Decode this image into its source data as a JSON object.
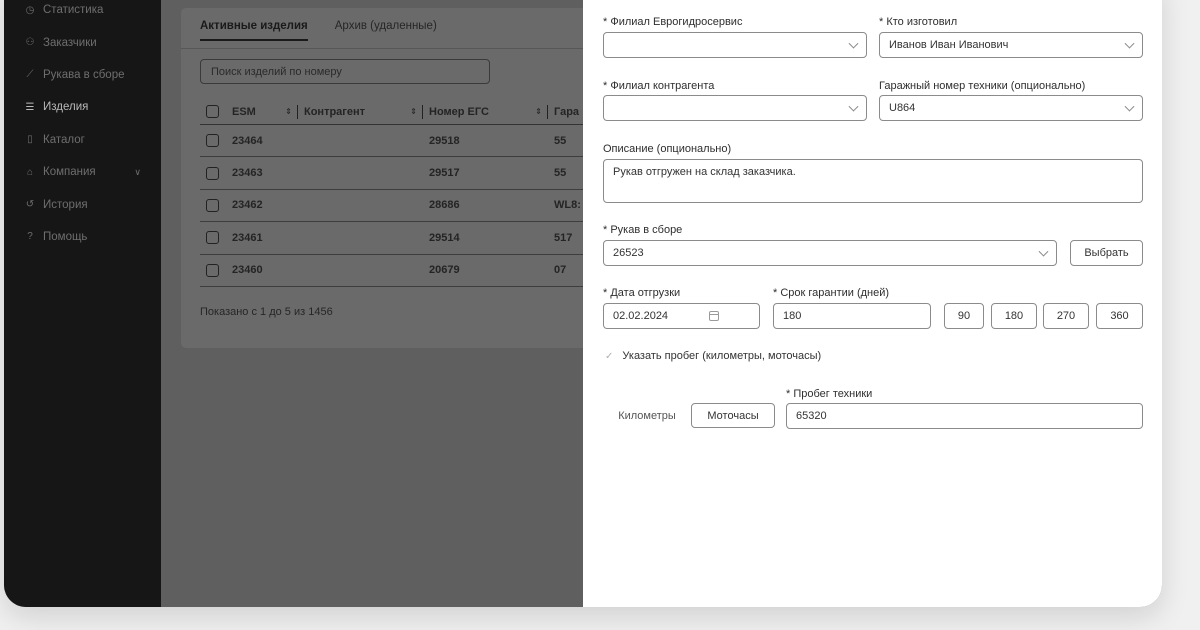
{
  "sidebar": {
    "items": [
      {
        "label": "Статистика",
        "icon": "clock-icon"
      },
      {
        "label": "Заказчики",
        "icon": "users-icon"
      },
      {
        "label": "Рукава в сборе",
        "icon": "hose-icon"
      },
      {
        "label": "Изделия",
        "icon": "list-icon",
        "active": true
      },
      {
        "label": "Каталог",
        "icon": "book-icon"
      },
      {
        "label": "Компания",
        "icon": "home-icon",
        "chevron": true
      },
      {
        "label": "История",
        "icon": "history-icon"
      },
      {
        "label": "Помощь",
        "icon": "help-icon"
      }
    ]
  },
  "main": {
    "tabs": [
      "Активные изделия",
      "Архив (удаленные)"
    ],
    "search_placeholder": "Поиск изделий по номеру",
    "table": {
      "headers": [
        "ESM",
        "Контрагент",
        "Номер ЕГС",
        "Гара"
      ],
      "rows": [
        [
          "23464",
          "",
          "29518",
          "55"
        ],
        [
          "23463",
          "",
          "29517",
          "55"
        ],
        [
          "23462",
          "",
          "28686",
          "WL8:"
        ],
        [
          "23461",
          "",
          "29514",
          "517"
        ],
        [
          "23460",
          "",
          "20679",
          "07"
        ]
      ]
    },
    "footer": "Показано с 1 до 5 из 1456"
  },
  "form": {
    "branch_label": "* Филиал Еврогидросервис",
    "branch_value": "",
    "maker_label": "* Кто изготовил",
    "maker_value": "Иванов Иван Иванович",
    "counterparty_branch_label": "* Филиал контрагента",
    "counterparty_branch_value": "",
    "garage_label": "Гаражный номер техники (опционально)",
    "garage_value": "U864",
    "description_label": "Описание (опционально)",
    "description_value": "Рукав отгружен на склад заказчика.",
    "hose_label": "* Рукав в сборе",
    "hose_value": "26523",
    "choose_button": "Выбрать",
    "ship_date_label": "* Дата отгрузки",
    "ship_date_value": "02.02.2024",
    "warranty_label": "* Срок гарантии (дней)",
    "warranty_value": "180",
    "warranty_presets": [
      "90",
      "180",
      "270",
      "360"
    ],
    "mileage_checkbox_label": "Указать пробег (километры, моточасы)",
    "mileage_checked": true,
    "unit_options": [
      "Километры",
      "Моточасы"
    ],
    "unit_selected": "Моточасы",
    "mileage_label": "* Пробег техники",
    "mileage_value": "65320"
  }
}
